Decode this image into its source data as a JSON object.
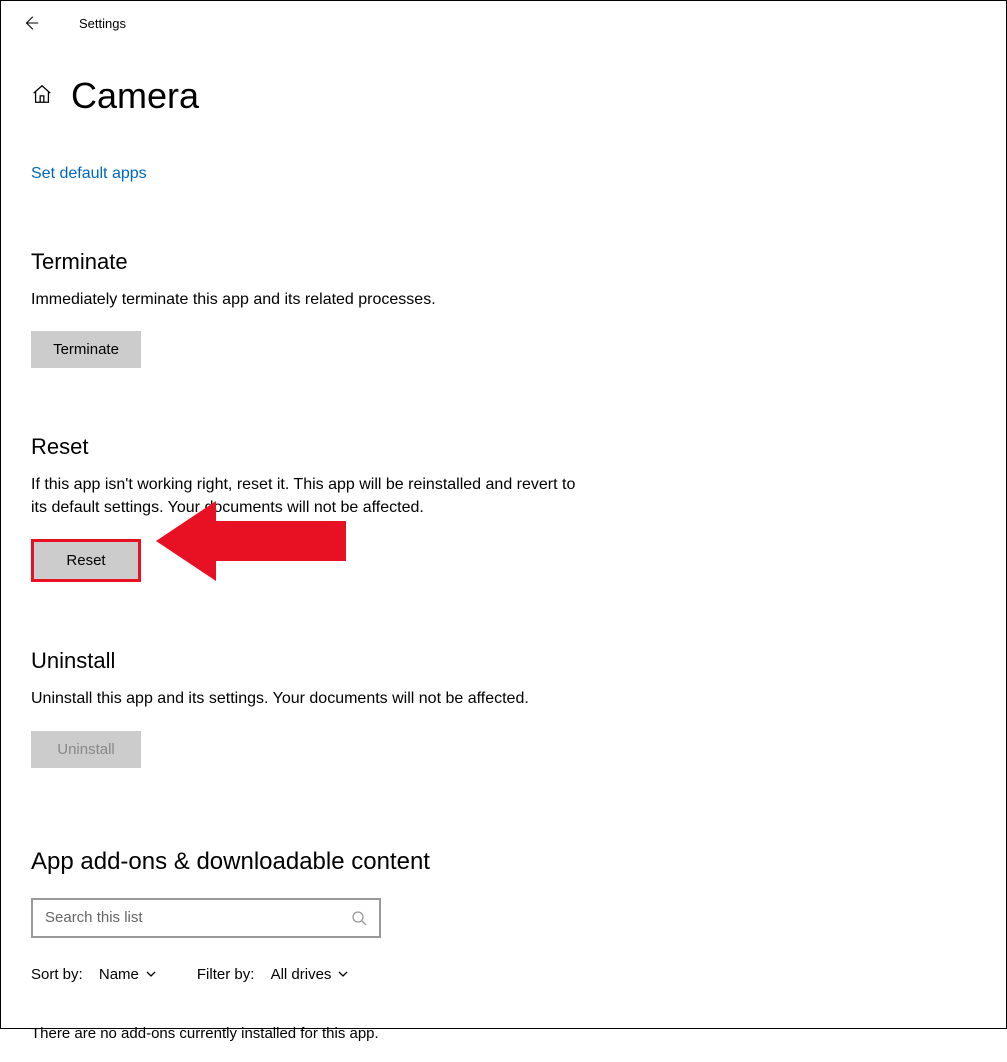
{
  "titlebar": {
    "app_label": "Settings"
  },
  "page": {
    "title": "Camera"
  },
  "links": {
    "set_default": "Set default apps"
  },
  "terminate": {
    "title": "Terminate",
    "desc": "Immediately terminate this app and its related processes.",
    "button": "Terminate"
  },
  "reset": {
    "title": "Reset",
    "desc": "If this app isn't working right, reset it. This app will be reinstalled and revert to its default settings. Your documents will not be affected.",
    "button": "Reset"
  },
  "uninstall": {
    "title": "Uninstall",
    "desc": "Uninstall this app and its settings. Your documents will not be affected.",
    "button": "Uninstall"
  },
  "addons": {
    "title": "App add-ons & downloadable content",
    "search_placeholder": "Search this list",
    "sort_label": "Sort by:",
    "sort_value": "Name",
    "filter_label": "Filter by:",
    "filter_value": "All drives",
    "empty": "There are no add-ons currently installed for this app."
  },
  "annotation": {
    "arrow_color": "#e81123"
  }
}
